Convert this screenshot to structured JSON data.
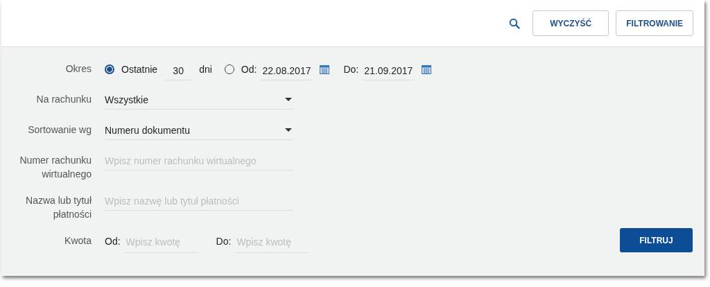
{
  "toolbar": {
    "buttons": [
      {
        "label": "WYCZYŚĆ"
      },
      {
        "label": "FILTROWANIE"
      }
    ]
  },
  "period": {
    "label": "Okres",
    "options": [
      {
        "kind": "last",
        "selected": true,
        "label": "Ostatnie",
        "value": "30",
        "unit": "dni"
      },
      {
        "kind": "range",
        "selected": false,
        "from_label": "Od:",
        "from": "22.08.2017",
        "to_label": "Do:",
        "to": "21.09.2017"
      }
    ]
  },
  "fields": [
    {
      "kind": "select",
      "label": "Na rachunku",
      "value": "Wszystkie"
    },
    {
      "kind": "select",
      "label": "Sortowanie wg",
      "value": "Numeru dokumentu"
    },
    {
      "kind": "text",
      "label": "Numer rachunku wirtualnego",
      "placeholder": "Wpisz numer rachunku wirtualnego"
    },
    {
      "kind": "text",
      "label": "Nazwa lub tytuł płatności",
      "placeholder": "Wpisz nazwę lub tytuł płatności"
    }
  ],
  "amount": {
    "label": "Kwota",
    "from_label": "Od:",
    "from_placeholder": "Wpisz kwotę",
    "to_label": "Do:",
    "to_placeholder": "Wpisz kwotę"
  },
  "submit": {
    "label": "FILTRUJ"
  }
}
